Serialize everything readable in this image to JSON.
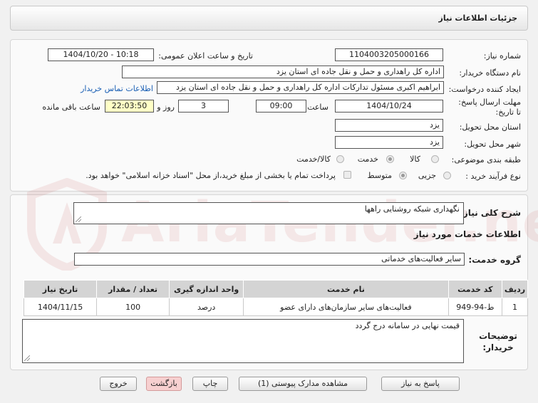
{
  "header": {
    "title": "جزئیات اطلاعات نیاز"
  },
  "form": {
    "need_number_label": "شماره نیاز:",
    "need_number": "1104003205000166",
    "announce_label": "تاریخ و ساعت اعلان عمومی:",
    "announce_value": "1404/10/20 - 10:18",
    "buyer_org_label": "نام دستگاه خریدار:",
    "buyer_org": "اداره کل راهداری و حمل و نقل جاده ای استان یزد",
    "creator_label": "ایجاد کننده درخواست:",
    "creator": "ابراهیم اکبری مسئول تدارکات اداره کل راهداری و حمل و نقل جاده ای استان یزد",
    "contact_link": "اطلاعات تماس خریدار",
    "deadline_label": "مهلت ارسال پاسخ: تا تاریخ:",
    "deadline_date": "1404/10/24",
    "time_label": "ساعت",
    "deadline_time": "09:00",
    "days_value": "3",
    "days_label": "روز و",
    "remaining_time": "22:03:50",
    "remaining_label": "ساعت باقی مانده",
    "province_label": "استان محل تحویل:",
    "province": "یزد",
    "city_label": "شهر محل تحویل:",
    "city": "یزد",
    "category_label": "طبقه بندی موضوعی:",
    "category_options": [
      "کالا",
      "خدمت",
      "کالا/خدمت"
    ],
    "process_label": "نوع فرآیند خرید :",
    "process_options": [
      "جزیی",
      "متوسط"
    ],
    "payment_note": "پرداخت تمام یا بخشی از مبلغ خرید،از محل \"اسناد خزانه اسلامی\" خواهد بود."
  },
  "need": {
    "desc_label": "شرح کلی نیاز:",
    "desc": "نگهداری شبکه روشنایی راهها",
    "services_title": "اطلاعات خدمات مورد نیاز",
    "group_label": "گروه خدمت:",
    "group_value": "سایر فعالیت‌های خدماتی"
  },
  "table": {
    "headers": [
      "ردیف",
      "کد خدمت",
      "نام خدمت",
      "واحد اندازه گیری",
      "تعداد / مقدار",
      "تاریخ نیاز"
    ],
    "rows": [
      [
        "1",
        "ط-94-949",
        "فعالیت‌های سایر سازمان‌های دارای عضو",
        "درصد",
        "100",
        "1404/11/15"
      ]
    ]
  },
  "notes": {
    "label": "توضیحات خریدار:",
    "value": "قیمت نهایی در سامانه درج گردد"
  },
  "buttons": {
    "reply": "پاسخ به نیاز",
    "docs": "مشاهده مدارک پیوستی (1)",
    "print": "چاپ",
    "back": "بازگشت",
    "exit": "خروج"
  },
  "watermark": {
    "text": "AriaTender.net"
  },
  "colors": {
    "accent_link": "#1a5fb4",
    "highlight": "#ffffc6",
    "pink_button": "#f7d0d0"
  }
}
